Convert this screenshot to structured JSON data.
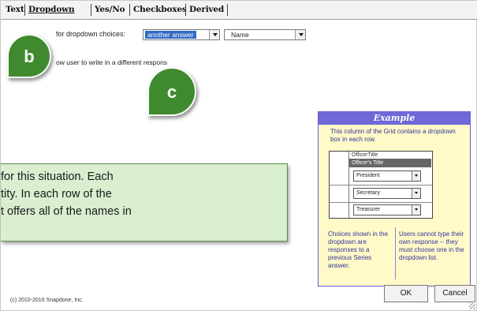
{
  "tabs": [
    {
      "label": "Text"
    },
    {
      "label": "Dropdown",
      "active": true
    },
    {
      "label": "Yes/No"
    },
    {
      "label": "Checkboxes"
    },
    {
      "label": "Derived"
    }
  ],
  "form": {
    "choices_label": "for dropdown choices:",
    "choice_source_value": "another answer",
    "choice_field_value": "Name",
    "write_in_label": "ow user to write in a different respons"
  },
  "callouts": {
    "b": "b",
    "c": "c"
  },
  "example": {
    "title": "Example",
    "description": "This column of the Grid contains a dropdown box in each row.",
    "grid_header_1": "OfficerTitle",
    "grid_header_2": "Officer's Title",
    "rows": [
      "President",
      "Secretary",
      "Treasurer"
    ],
    "left_note": "Choices shown in the dropdown are responses to a previous Series answer.",
    "right_note": "Users cannot type their own response -- they must choose one in the dropdown list."
  },
  "info": {
    "line1": "for this situation. Each",
    "line2": "tity. In each row of the",
    "line3": "t offers all of the names in"
  },
  "footer": {
    "copyright": "(c) 2010-2016 Snapdone, Inc."
  },
  "buttons": {
    "ok": "OK",
    "cancel": "Cancel"
  },
  "colors": {
    "callout_green": "#3f8a2e",
    "info_bg": "#d9efd0",
    "example_header": "#6f69d8",
    "example_bg": "#fffac8"
  }
}
